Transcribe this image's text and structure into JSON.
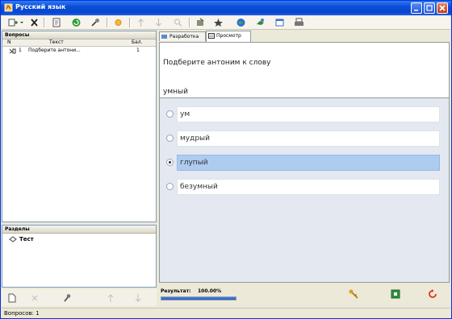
{
  "window": {
    "title": "Русский язык"
  },
  "toolbar": {
    "icons": [
      "add-question-icon",
      "dropdown-arrow-icon",
      "delete-icon",
      "edit-icon",
      "refresh-icon",
      "tools-icon",
      "sun-icon",
      "arrow-up-icon",
      "arrow-down-icon",
      "search-icon",
      "import-icon",
      "star-icon",
      "globe-icon",
      "green-arrow-icon",
      "window-icon",
      "printer-icon"
    ]
  },
  "questions_panel": {
    "title": "Вопросы",
    "columns": [
      "N",
      "Текст",
      "Бал."
    ],
    "rows": [
      {
        "n": "1",
        "text": "Подберите антони...",
        "score": "1"
      }
    ]
  },
  "sections_panel": {
    "title": "Разделы",
    "item": "Тест"
  },
  "tabs": [
    {
      "label": "Разработка",
      "active": false
    },
    {
      "label": "Просмотр",
      "active": true
    }
  ],
  "question": {
    "text": "Подберите антоним к слову",
    "word": "умный"
  },
  "answers": [
    {
      "text": "ум",
      "checked": false,
      "selected": false
    },
    {
      "text": "мудрый",
      "checked": false,
      "selected": false
    },
    {
      "text": "глупый",
      "checked": true,
      "selected": true
    },
    {
      "text": "безумный",
      "checked": false,
      "selected": false
    }
  ],
  "result": {
    "label": "Результат:",
    "value": "100.00%",
    "progress": 1.0
  },
  "status": {
    "text": "Вопросов: 1"
  },
  "colors": {
    "titlebar": "#0a4ed6",
    "selected_answer": "#aecbf0",
    "progress": "#2a5cc0"
  }
}
